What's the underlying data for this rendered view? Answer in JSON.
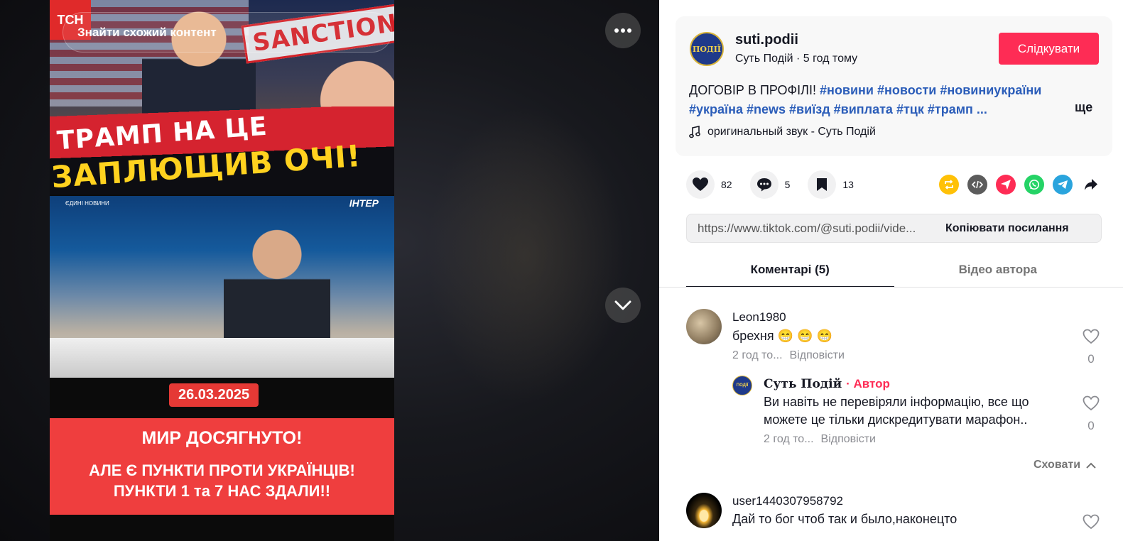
{
  "video": {
    "search_similar_text": "Знайти схожий контент",
    "channel_logo": "ТСН",
    "stamp_text": "SANCTIONS",
    "headline_line1": "ТРАМП НА ЦЕ",
    "headline_line2": "ЗАПЛЮЩИВ ОЧІ!",
    "studio_logo_left": "ЄДИНІ НОВИНИ",
    "studio_logo_right": "ІНТЕР",
    "date_badge": "26.03.2025",
    "panel_line1": "МИР ДОСЯГНУТО!",
    "panel_line2": "АЛЕ Є ПУНКТИ ПРОТИ УКРАЇНЦІВ!",
    "panel_line3": "ПУНКТИ 1 та 7 НАС ЗДАЛИ!!"
  },
  "post": {
    "avatar_text": "ПОДІЇ",
    "username": "suti.podii",
    "subline": "Суть Подій · 5 год тому",
    "follow_label": "Слідкувати",
    "caption_text": "ДОГОВІР В ПРОФІЛІ!",
    "hashtags": [
      "#новини",
      "#новости",
      "#новиниукраїни",
      "#україна",
      "#news",
      "#виїзд",
      "#виплата",
      "#тцк",
      "#трамп"
    ],
    "ellipsis": "...",
    "more_label": "ще",
    "sound": "оригинальный звук - Суть Подій"
  },
  "actions": {
    "likes": "82",
    "comments": "5",
    "saves": "13"
  },
  "share_colors": {
    "repost": "#ffc107",
    "embed": "#5c5c5c",
    "send": "#fe2c55",
    "whatsapp": "#25d366",
    "telegram": "#2aa4dd"
  },
  "link": {
    "url": "https://www.tiktok.com/@suti.podii/vide...",
    "copy_label": "Копіювати посилання"
  },
  "tabs": {
    "comments": "Коментарі (5)",
    "author_videos": "Відео автора"
  },
  "comments": [
    {
      "user": "Leon1980",
      "text": "брехня 😁 😁 😁",
      "time": "2 год то...",
      "reply": "Відповісти",
      "likes": "0"
    },
    {
      "user": "Суть Подій",
      "author_label": "· Автор",
      "text": "Ви навіть не перевіряли інформацію, все що можете це тільки дискредитувати марафон..",
      "time": "2 год то...",
      "reply": "Відповісти",
      "likes": "0"
    },
    {
      "user": "user1440307958792",
      "text": "Дай то бог чтоб так и было,наконецто"
    }
  ],
  "hide_label": "Сховати"
}
